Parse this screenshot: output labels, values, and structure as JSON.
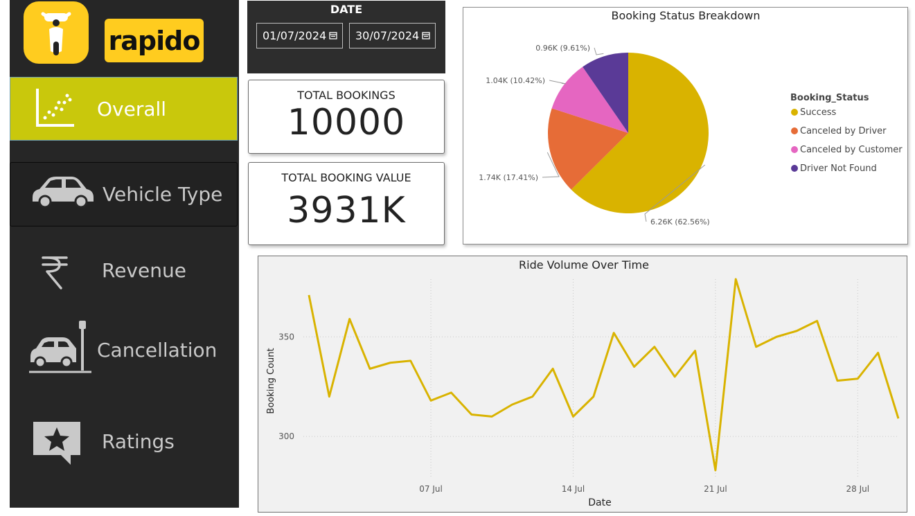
{
  "brand": {
    "name": "rapido"
  },
  "sidebar": {
    "items": [
      {
        "label": "Overall",
        "icon": "scatter-chart-icon",
        "active": true
      },
      {
        "label": "Vehicle Type",
        "icon": "car-icon"
      },
      {
        "label": "Revenue",
        "icon": "rupee-icon"
      },
      {
        "label": "Cancellation",
        "icon": "car-crash-icon"
      },
      {
        "label": "Ratings",
        "icon": "star-comment-icon"
      }
    ]
  },
  "date_filter": {
    "title": "DATE",
    "start": "01/07/2024",
    "end": "30/07/2024"
  },
  "kpis": {
    "total_bookings": {
      "label": "TOTAL BOOKINGS",
      "value": "10000"
    },
    "total_booking_value": {
      "label": "TOTAL BOOKING VALUE",
      "value": "3931K"
    }
  },
  "colors": {
    "accent": "#c9c80c",
    "brand_yellow": "#ffcc1f",
    "sidebar_bg": "#262626",
    "success": "#d9b300",
    "canceled_by_driver": "#e66c37",
    "canceled_by_customer": "#e566c1",
    "driver_not_found": "#5a3a97"
  },
  "chart_data": [
    {
      "type": "pie",
      "title": "Booking Status Breakdown",
      "legend_title": "Booking_Status",
      "legend_position": "right",
      "slices": [
        {
          "name": "Success",
          "value": 6.26,
          "percent": 62.56,
          "label": "6.26K (62.56%)",
          "color": "#d9b300"
        },
        {
          "name": "Canceled by Driver",
          "value": 1.74,
          "percent": 17.41,
          "label": "1.74K (17.41%)",
          "color": "#e66c37"
        },
        {
          "name": "Canceled by Customer",
          "value": 1.04,
          "percent": 10.42,
          "label": "1.04K (10.42%)",
          "color": "#e566c1"
        },
        {
          "name": "Driver Not Found",
          "value": 0.96,
          "percent": 9.61,
          "label": "0.96K (9.61%)",
          "color": "#5a3a97"
        }
      ]
    },
    {
      "type": "line",
      "title": "Ride Volume Over Time",
      "xlabel": "Date",
      "ylabel": "Booking Count",
      "x_ticks": [
        "07 Jul",
        "14 Jul",
        "21 Jul",
        "28 Jul"
      ],
      "y_ticks": [
        300,
        350
      ],
      "ylim": [
        283,
        379
      ],
      "grid": true,
      "color": "#d9b300",
      "x": [
        "2024-07-01",
        "2024-07-02",
        "2024-07-03",
        "2024-07-04",
        "2024-07-05",
        "2024-07-06",
        "2024-07-07",
        "2024-07-08",
        "2024-07-09",
        "2024-07-10",
        "2024-07-11",
        "2024-07-12",
        "2024-07-13",
        "2024-07-14",
        "2024-07-15",
        "2024-07-16",
        "2024-07-17",
        "2024-07-18",
        "2024-07-19",
        "2024-07-20",
        "2024-07-21",
        "2024-07-22",
        "2024-07-23",
        "2024-07-24",
        "2024-07-25",
        "2024-07-26",
        "2024-07-27",
        "2024-07-28",
        "2024-07-29",
        "2024-07-30"
      ],
      "values": [
        371,
        320,
        359,
        334,
        337,
        338,
        318,
        322,
        311,
        310,
        316,
        320,
        334,
        310,
        320,
        352,
        335,
        345,
        330,
        343,
        283,
        379,
        345,
        350,
        353,
        358,
        328,
        329,
        342,
        309
      ]
    }
  ]
}
